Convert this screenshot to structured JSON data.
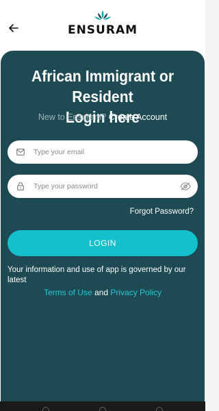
{
  "header": {
    "back_icon": "arrow-left-icon",
    "logo_text": "ENSURAM",
    "logo_icon": "leaf-crown-icon",
    "logo_colors": [
      "#1aa7b0",
      "#1e4a54"
    ]
  },
  "login": {
    "title_line1": "African Immigrant or Resident",
    "title_line2": "Login here",
    "new_prompt": "New to Ensuram?",
    "create_account": "Create Account",
    "email_placeholder": "Type your email",
    "password_placeholder": "Type your password",
    "forgot_password": "Forgot Password?",
    "login_button": "LOGIN",
    "info_text": "Your information and use of app is governed by our latest",
    "terms_link": "Terms of Use",
    "and_text": "and",
    "privacy_link": "Privacy Policy"
  },
  "colors": {
    "panel": "#1e4a54",
    "accent": "#14c0cc",
    "link": "#28c8d6"
  }
}
